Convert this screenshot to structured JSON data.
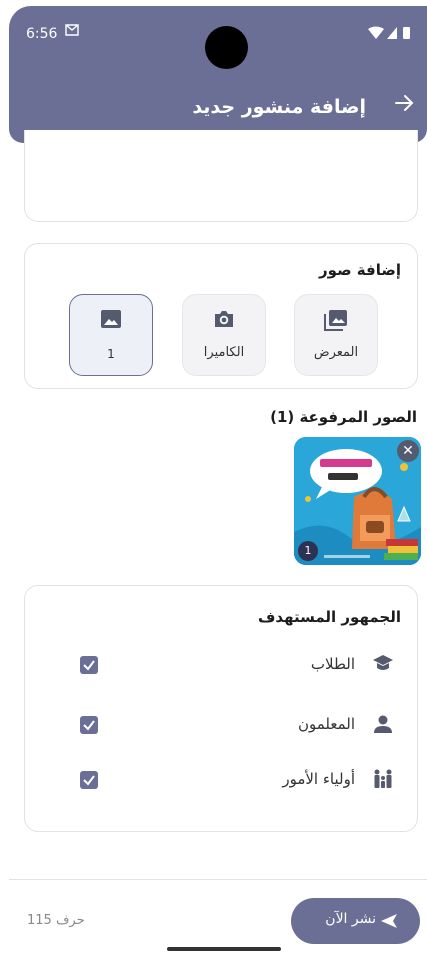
{
  "status_bar": {
    "time": "6:56",
    "mail_icon": "gmail-icon",
    "right_icons": "wifi-icon signal-icon battery-icon"
  },
  "header": {
    "title": "إضافة منشور جديد",
    "back_icon": "arrow-right-icon"
  },
  "photos": {
    "title": "إضافة صور",
    "gallery_label": "المعرض",
    "camera_label": "الكاميرا",
    "count_label": "1"
  },
  "uploaded": {
    "title": "الصور المرفوعة (1)",
    "remove_symbol": "✕",
    "index": "1"
  },
  "audience": {
    "title": "الجمهور المستهدف",
    "items": [
      {
        "label": "الطلاب",
        "icon": "graduation-cap-icon",
        "checked": true
      },
      {
        "label": "المعلمون",
        "icon": "person-icon",
        "checked": true
      },
      {
        "label": "أولياء الأمور",
        "icon": "family-icon",
        "checked": true
      }
    ]
  },
  "footer": {
    "char_count": "115 حرف",
    "publish_label": "نشر الآن",
    "publish_icon": "send-icon"
  },
  "colors": {
    "primary": "#6b6f96",
    "header_bg": "#6b6f96",
    "card_border": "#e2e2e6"
  }
}
